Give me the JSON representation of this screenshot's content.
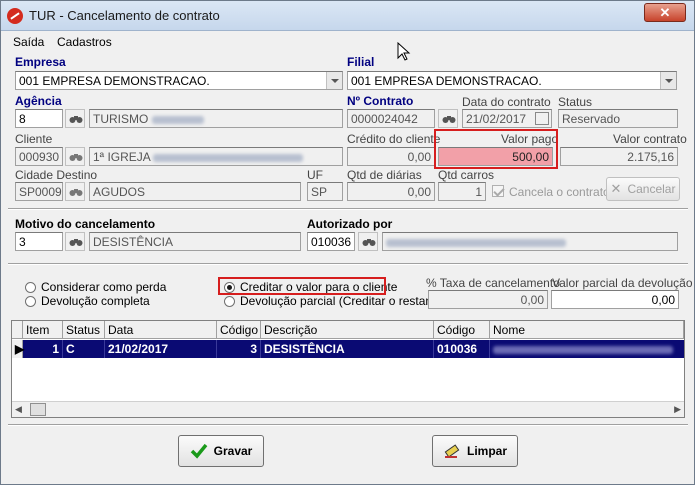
{
  "window": {
    "title": "TUR - Cancelamento de contrato",
    "close_glyph": "✕"
  },
  "menu": {
    "items": [
      "Saída",
      "Cadastros"
    ]
  },
  "empresa": {
    "label": "Empresa",
    "value": "001 EMPRESA DEMONSTRACAO."
  },
  "filial": {
    "label": "Filial",
    "value": "001 EMPRESA DEMONSTRACAO."
  },
  "agencia": {
    "label": "Agência",
    "code": "8",
    "name": "TURISMO"
  },
  "contrato": {
    "label": "Nº Contrato",
    "value": "0000024042"
  },
  "data_contrato": {
    "label": "Data do contrato",
    "value": "21/02/2017"
  },
  "status": {
    "label": "Status",
    "value": "Reservado"
  },
  "cliente": {
    "label": "Cliente",
    "code": "000930",
    "name": "1ª IGREJA"
  },
  "credito": {
    "label": "Crédito do cliente",
    "value": "0,00"
  },
  "valor_pago": {
    "label": "Valor pago",
    "value": "500,00"
  },
  "valor_contrato": {
    "label": "Valor contrato",
    "value": "2.175,16"
  },
  "cidade": {
    "label": "Cidade Destino",
    "code": "SP0009",
    "name": "AGUDOS"
  },
  "uf": {
    "label": "UF",
    "value": "SP"
  },
  "qtd_diarias": {
    "label": "Qtd de diárias",
    "value": "0,00"
  },
  "qtd_carros": {
    "label": "Qtd carros",
    "value": "1"
  },
  "cancela_contrato": {
    "label": "Cancela o contrato",
    "checked": true
  },
  "cancelar_button": {
    "label": "Cancelar"
  },
  "motivo": {
    "label": "Motivo do cancelamento",
    "code": "3",
    "name": "DESISTÊNCIA"
  },
  "autorizado": {
    "label": "Autorizado por",
    "code": "010036"
  },
  "options": {
    "considerar_perda": "Considerar como perda",
    "devolucao_completa": "Devolução completa",
    "creditar_cliente": "Creditar o valor para o cliente",
    "devolucao_parcial": "Devolução parcial (Creditar o restante)",
    "selected": "creditar_cliente"
  },
  "taxa": {
    "label": "% Taxa de cancelamento",
    "value": "0,00"
  },
  "valor_parcial": {
    "label": "Valor parcial da devolução",
    "value": "0,00"
  },
  "table": {
    "columns": [
      "Item",
      "Status",
      "Data",
      "Código",
      "Descrição",
      "Código",
      "Nome"
    ],
    "rows": [
      {
        "item": "1",
        "status": "C",
        "data": "21/02/2017",
        "codigo": "3",
        "descricao": "DESISTÊNCIA",
        "codigo2": "010036",
        "nome": ""
      }
    ]
  },
  "buttons": {
    "gravar": "Gravar",
    "limpar": "Limpar"
  },
  "colors": {
    "highlight": "#d61e1e",
    "valor_pago_bg": "#f2a0a8",
    "label_blue": "#000080",
    "selection": "#0a0a73"
  }
}
